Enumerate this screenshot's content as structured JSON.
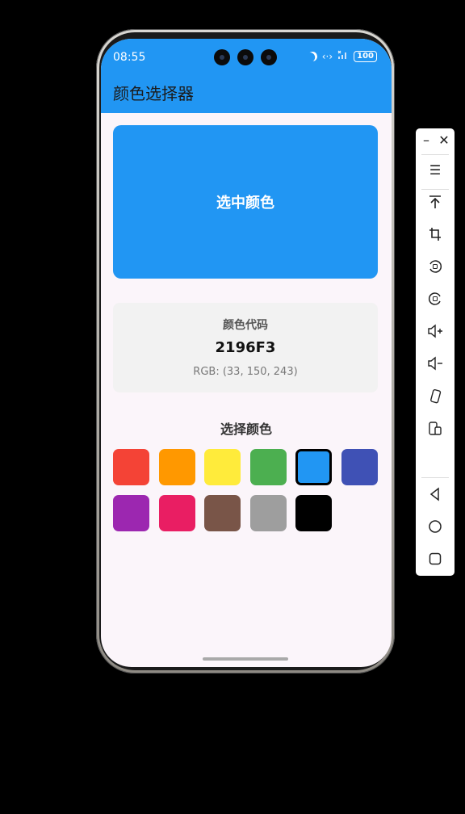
{
  "status_bar": {
    "time": "08:55",
    "battery": "100"
  },
  "app_bar": {
    "title": "颜色选择器"
  },
  "preview": {
    "label": "选中颜色",
    "color": "#2196F3"
  },
  "color_info": {
    "label": "颜色代码",
    "hex": "2196F3",
    "rgb": "RGB: (33, 150, 243)"
  },
  "palette": {
    "title": "选择颜色",
    "swatches": [
      {
        "color": "#F44336",
        "selected": false
      },
      {
        "color": "#FF9800",
        "selected": false
      },
      {
        "color": "#FFEB3B",
        "selected": false
      },
      {
        "color": "#4CAF50",
        "selected": false
      },
      {
        "color": "#2196F3",
        "selected": true
      },
      {
        "color": "#3F51B5",
        "selected": false
      },
      {
        "color": "#9C27B0",
        "selected": false
      },
      {
        "color": "#E91E63",
        "selected": false
      },
      {
        "color": "#795548",
        "selected": false
      },
      {
        "color": "#9E9E9E",
        "selected": false
      },
      {
        "color": "#000000",
        "selected": false
      }
    ]
  },
  "emulator_toolbar": {
    "icons": [
      "minimize-icon",
      "close-icon",
      "menu-icon",
      "pin-top-icon",
      "crop-icon",
      "rotate-left-icon",
      "rotate-right-icon",
      "volume-up-icon",
      "volume-down-icon",
      "shake-icon",
      "multi-screen-icon",
      "back-icon",
      "home-icon",
      "recents-icon"
    ]
  }
}
